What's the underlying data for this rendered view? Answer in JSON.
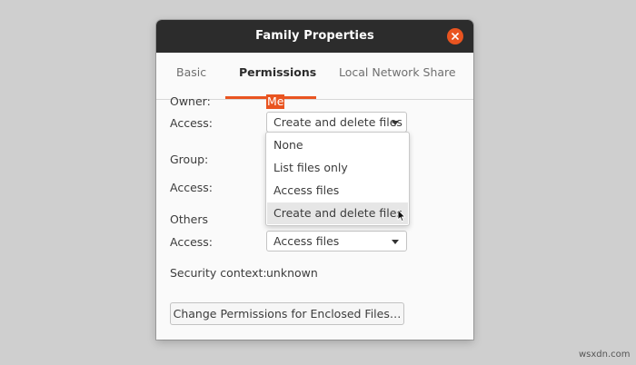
{
  "window": {
    "title": "Family Properties",
    "close_label": "×"
  },
  "tabs": [
    {
      "label": "Basic",
      "active": false
    },
    {
      "label": "Permissions",
      "active": true
    },
    {
      "label": "Local Network Share",
      "active": false
    }
  ],
  "permissions": {
    "owner_label": "Owner:",
    "owner_value": "Me",
    "owner_access_label": "Access:",
    "owner_access_value": "Create and delete files",
    "group_label": "Group:",
    "group_access_label": "Access:",
    "others_label": "Others",
    "others_access_label": "Access:",
    "others_access_value": "Access files",
    "security_label": "Security context:",
    "security_value": "unknown",
    "enclosed_button": "Change Permissions for Enclosed Files…"
  },
  "dropdown": {
    "options": [
      "None",
      "List files only",
      "Access files",
      "Create and delete files"
    ],
    "hovered_index": 3
  },
  "watermark": "wsxdn.com",
  "colors": {
    "accent": "#e95420",
    "titlebar": "#2c2c2c",
    "background": "#cfcfcf"
  }
}
